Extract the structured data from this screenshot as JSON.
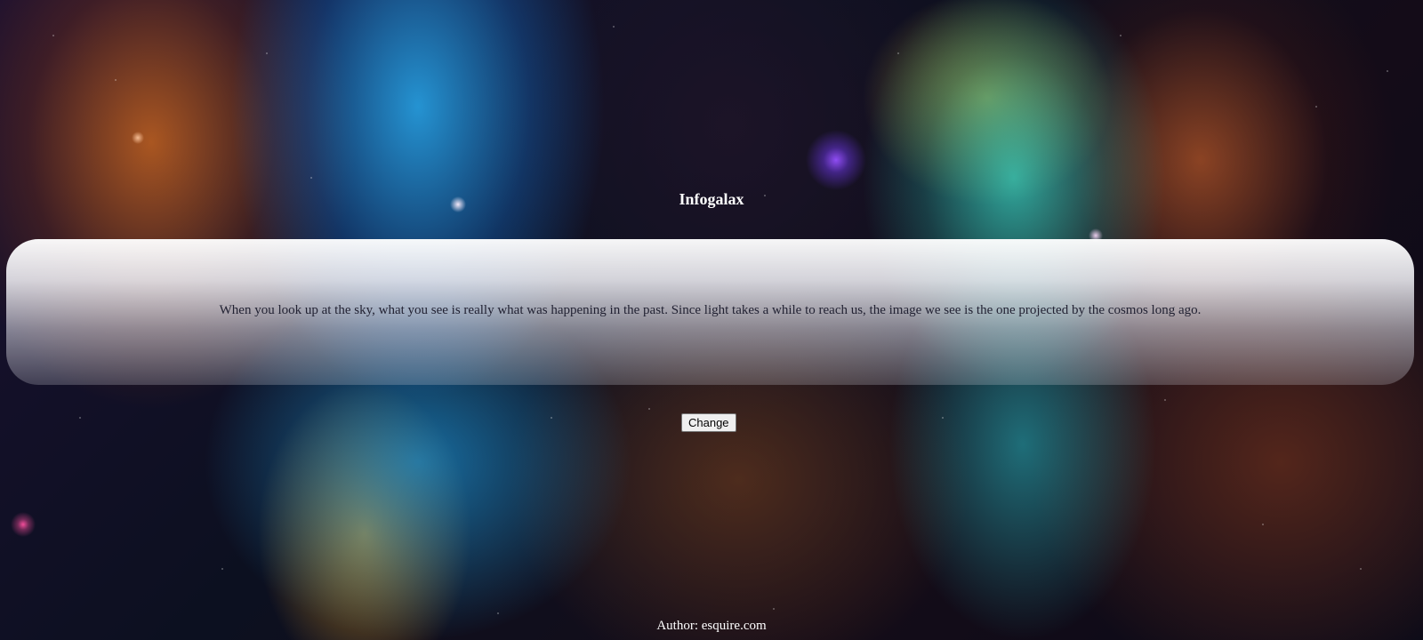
{
  "page": {
    "title": "Infogalax"
  },
  "fact": {
    "text": "When you look up at the sky, what you see is really what was happening in the past. Since light takes a while to reach us, the image we see is the one projected by the cosmos long ago."
  },
  "controls": {
    "change_label": "Change"
  },
  "footer": {
    "author": "Author: esquire.com"
  },
  "background": {
    "image_subject": "colorful nebula starfield"
  }
}
